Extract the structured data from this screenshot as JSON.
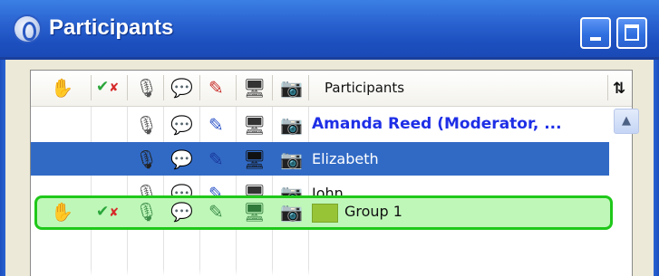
{
  "window": {
    "title": "Participants",
    "icon": "microphone-badge-icon",
    "controls": {
      "minimize": "minimize-icon",
      "maximize": "maximize-icon"
    }
  },
  "table": {
    "columns": [
      {
        "key": "raise_hand",
        "icon": "hand-icon"
      },
      {
        "key": "agree",
        "icon": "check-cross-icon"
      },
      {
        "key": "microphone",
        "icon": "microphone-icon"
      },
      {
        "key": "chat",
        "icon": "speech-bubble-icon"
      },
      {
        "key": "draw",
        "icon": "pencil-icon"
      },
      {
        "key": "screen",
        "icon": "monitor-icon"
      },
      {
        "key": "webcam",
        "icon": "webcam-icon"
      }
    ],
    "name_header": "Participants",
    "sort_icon": "sort-icon",
    "rows": [
      {
        "name": "Amanda Reed (Moderator, ...",
        "role": "moderator",
        "selected": false
      },
      {
        "name": "Elizabeth",
        "role": "participant",
        "selected": true
      },
      {
        "name": "John",
        "role": "participant",
        "selected": false
      },
      {
        "name": "Group 1",
        "role": "group",
        "selected": false,
        "group_color": "#97c437"
      }
    ]
  },
  "colors": {
    "titlebar": "#2a63d1",
    "selection": "#316ac5",
    "moderator_text": "#1e2fe6",
    "group_highlight": "#bff7b9",
    "group_border": "#1fc81a"
  }
}
